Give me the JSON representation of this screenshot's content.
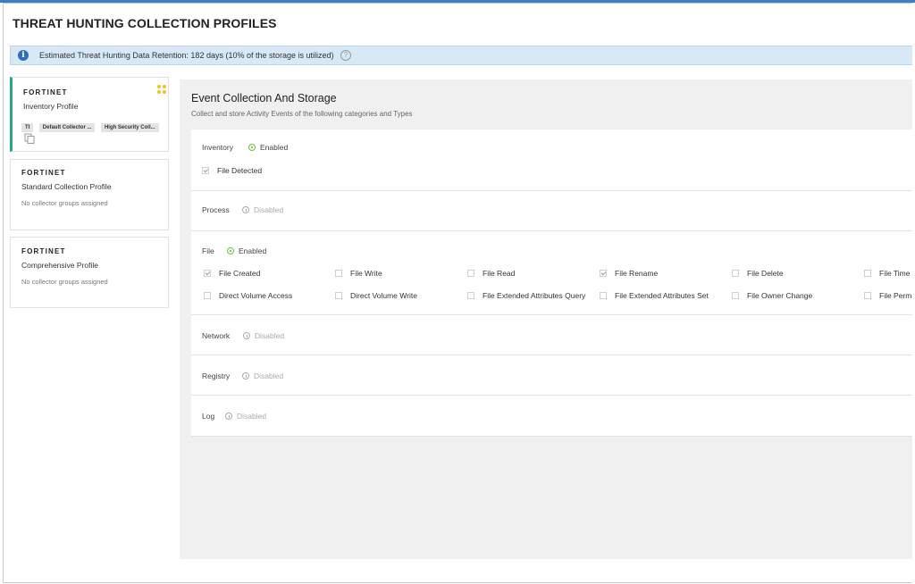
{
  "page": {
    "title": "THREAT HUNTING COLLECTION PROFILES"
  },
  "info": {
    "text": "Estimated Threat Hunting Data Retention: 182 days (10% of the storage is utilized)"
  },
  "brand": {
    "accent": "#2aa58a"
  },
  "profiles": [
    {
      "brand": "FORTINET",
      "name": "Inventory Profile",
      "tags": [
        "TI",
        "Default Collector ...",
        "High Security Coll..."
      ]
    },
    {
      "brand": "FORTINET",
      "name": "Standard Collection Profile",
      "subtext": "No collector groups assigned"
    },
    {
      "brand": "FORTINET",
      "name": "Comprehensive Profile",
      "subtext": "No collector groups assigned"
    }
  ],
  "main": {
    "title": "Event Collection And Storage",
    "subtitle": "Collect and store Activity Events of the following categories and Types"
  },
  "categories": [
    {
      "name": "Inventory",
      "status": "Enabled",
      "items": [
        {
          "label": "File Detected",
          "checked": true
        }
      ]
    },
    {
      "name": "Process",
      "status": "Disabled"
    },
    {
      "name": "File",
      "status": "Enabled",
      "items": [
        {
          "label": "File Created",
          "checked": true
        },
        {
          "label": "File Write",
          "checked": false
        },
        {
          "label": "File Read",
          "checked": false
        },
        {
          "label": "File Rename",
          "checked": true
        },
        {
          "label": "File Delete",
          "checked": false
        },
        {
          "label": "File Time S",
          "checked": false
        },
        {
          "label": "Direct Volume Access",
          "checked": false
        },
        {
          "label": "Direct Volume Write",
          "checked": false
        },
        {
          "label": "File Extended Attributes Query",
          "checked": false
        },
        {
          "label": "File Extended Attributes Set",
          "checked": false
        },
        {
          "label": "File Owner Change",
          "checked": false
        },
        {
          "label": "File Permis",
          "checked": false
        }
      ]
    },
    {
      "name": "Network",
      "status": "Disabled"
    },
    {
      "name": "Registry",
      "status": "Disabled"
    },
    {
      "name": "Log",
      "status": "Disabled"
    }
  ]
}
